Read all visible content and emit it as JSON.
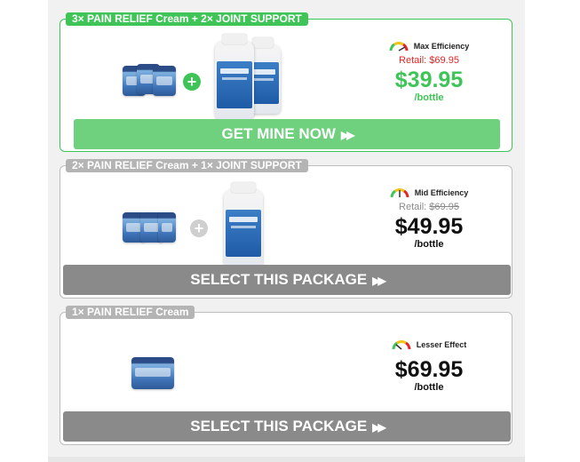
{
  "colors": {
    "accent_green": "#3fc557",
    "cta_green": "#6fd07e",
    "cta_gray": "#8a8a8a",
    "retail_red": "#e42525"
  },
  "packages": [
    {
      "tag": "3× PAIN RELIEF Cream + 2× JOINT SUPPORT",
      "efficiency": "Max Efficiency",
      "retail_label": "Retail:",
      "retail_price": "$69.95",
      "price": "$39.95",
      "per": "/bottle",
      "cta": "GET MINE NOW",
      "selected": true
    },
    {
      "tag": "2× PAIN RELIEF Cream + 1× JOINT SUPPORT",
      "efficiency": "Mid Efficiency",
      "retail_label": "Retail:",
      "retail_price": "$69.95",
      "price": "$49.95",
      "per": "/bottle",
      "cta": "SELECT THIS PACKAGE",
      "selected": false
    },
    {
      "tag": "1× PAIN RELIEF Cream",
      "efficiency": "Lesser Effect",
      "price": "$69.95",
      "per": "/bottle",
      "cta": "SELECT THIS PACKAGE",
      "selected": false
    }
  ]
}
